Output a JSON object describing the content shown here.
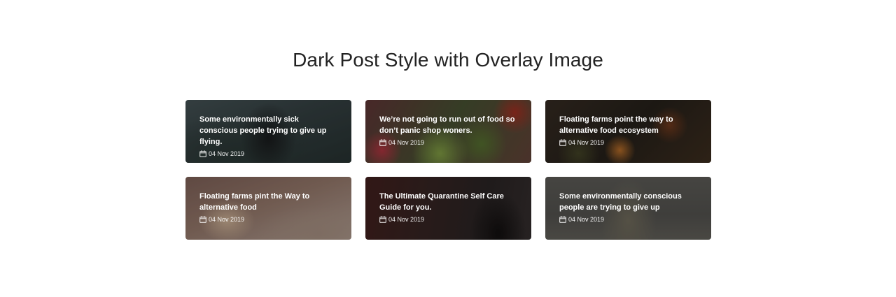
{
  "page": {
    "title": "Dark Post Style with Overlay Image"
  },
  "posts": [
    {
      "title": "Some environmentally sick conscious people trying to give up flying.",
      "date": "04 Nov 2019",
      "date_icon": "calendar-icon"
    },
    {
      "title": "We’re not going to run out of food so don’t panic shop woners.",
      "date": "04 Nov 2019",
      "date_icon": "calendar-icon"
    },
    {
      "title": "Floating farms point the way to alternative food ecosystem",
      "date": "04 Nov 2019",
      "date_icon": "calendar-icon"
    },
    {
      "title": "Floating farms pint the Way to alternative food",
      "date": "04 Nov 2019",
      "date_icon": "calendar-icon"
    },
    {
      "title": "The Ultimate Quarantine Self Care Guide for you.",
      "date": "04 Nov 2019",
      "date_icon": "calendar-icon"
    },
    {
      "title": "Some environmentally conscious people are trying to give up",
      "date": "04 Nov 2019",
      "date_icon": "calendar-icon"
    }
  ]
}
